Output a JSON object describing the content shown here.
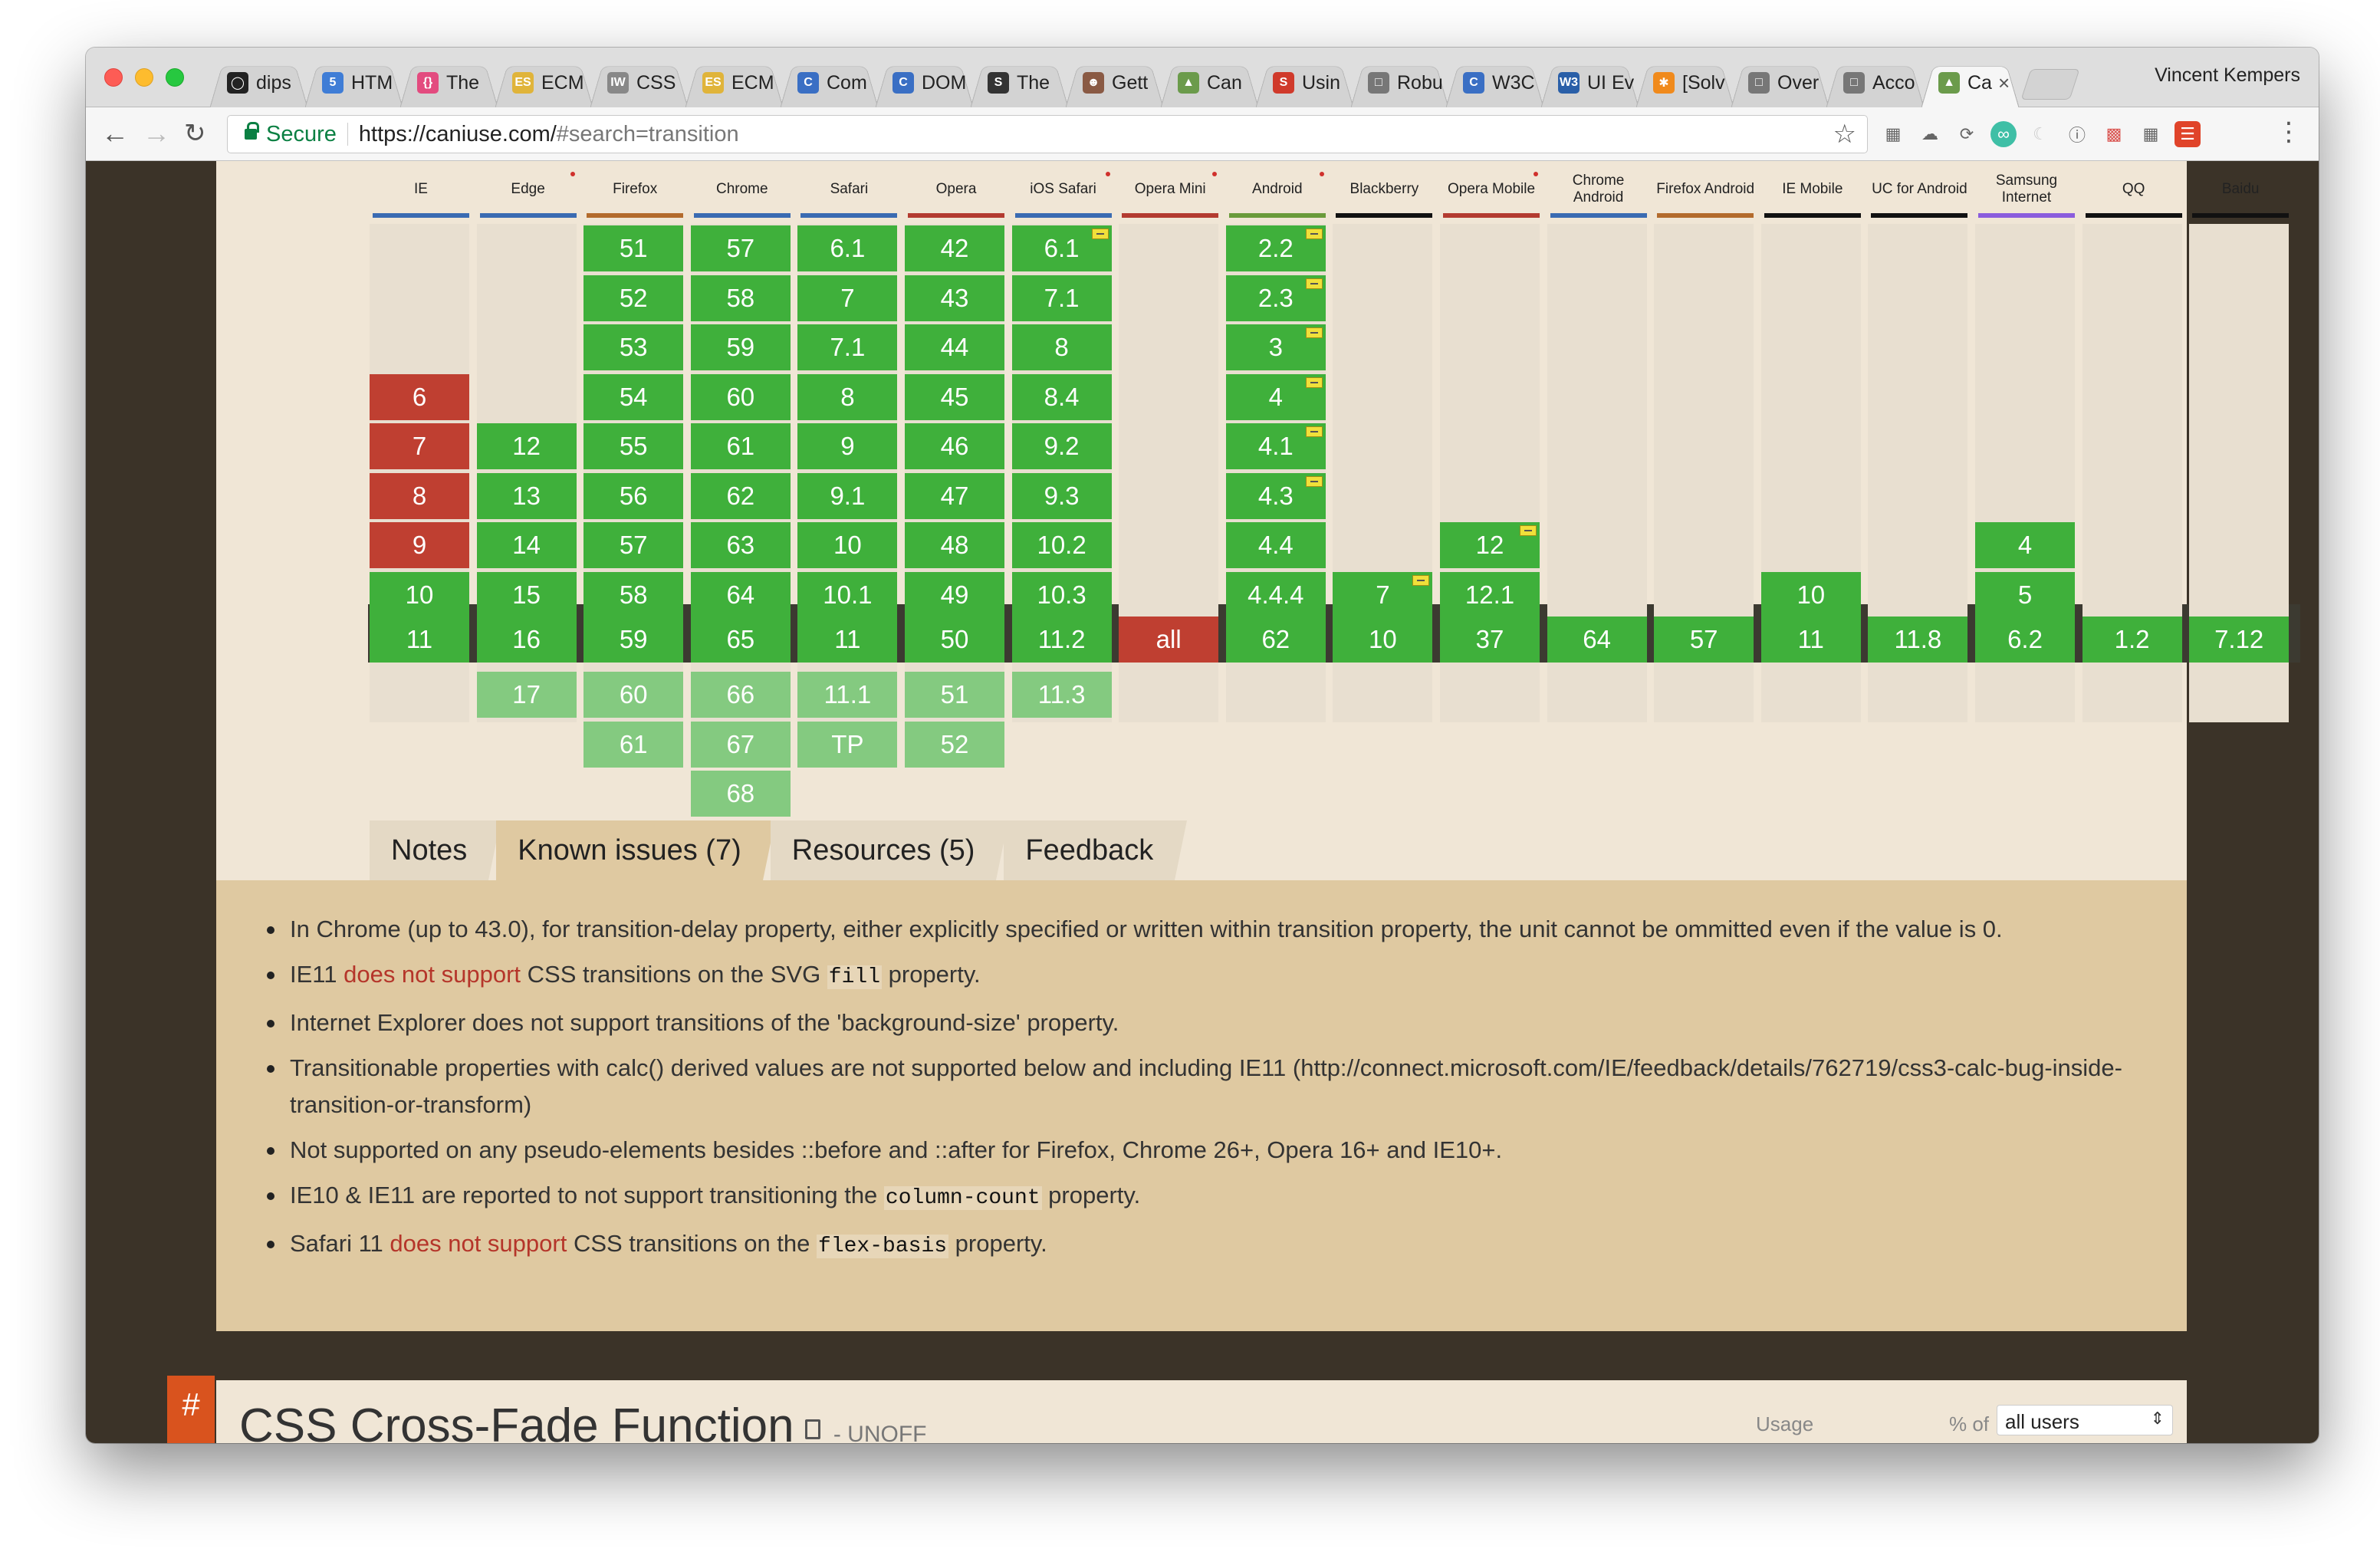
{
  "browser": {
    "tabs": [
      {
        "title": "dips",
        "icon": "github-icon",
        "color": "#222222"
      },
      {
        "title": "HTM",
        "icon": "html5-icon",
        "color": "#3f7dd6"
      },
      {
        "title": "The",
        "icon": "braces-icon",
        "color": "#e34b7f"
      },
      {
        "title": "ECM",
        "icon": "es-icon",
        "color": "#e0b43a"
      },
      {
        "title": "CSS",
        "icon": "iw-icon",
        "color": "#888888"
      },
      {
        "title": "ECM",
        "icon": "es-icon",
        "color": "#e0b43a"
      },
      {
        "title": "Com",
        "icon": "c-icon",
        "color": "#3a6fc4"
      },
      {
        "title": "DOM",
        "icon": "c-icon",
        "color": "#3a6fc4"
      },
      {
        "title": "The",
        "icon": "s-icon",
        "color": "#333333"
      },
      {
        "title": "Gett",
        "icon": "avatar-icon",
        "color": "#8a5a44"
      },
      {
        "title": "Can",
        "icon": "caniuse-icon",
        "color": "#6b9b4b"
      },
      {
        "title": "Usin",
        "icon": "s-red-icon",
        "color": "#d03a2b"
      },
      {
        "title": "Robu",
        "icon": "page-icon",
        "color": "#777777"
      },
      {
        "title": "W3C",
        "icon": "c-icon",
        "color": "#3a6fc4"
      },
      {
        "title": "UI Ev",
        "icon": "w3c-icon",
        "color": "#2a5fa8"
      },
      {
        "title": "[Solv",
        "icon": "asterisk-icon",
        "color": "#f08a1c"
      },
      {
        "title": "Over",
        "icon": "page-icon",
        "color": "#777777"
      },
      {
        "title": "Acco",
        "icon": "page-icon",
        "color": "#777777"
      },
      {
        "title": "Ca",
        "icon": "caniuse-icon",
        "color": "#6b9b4b",
        "active": true
      }
    ],
    "profile_name": "Vincent Kempers",
    "secure_label": "Secure",
    "url_host": "https://caniuse.com/",
    "url_rest": "#search=transition"
  },
  "browsers": [
    {
      "name": "IE",
      "color": "#3a6bb2",
      "dot": false
    },
    {
      "name": "Edge",
      "color": "#3a6bb2",
      "dot": true
    },
    {
      "name": "Firefox",
      "color": "#b36b2d",
      "dot": false
    },
    {
      "name": "Chrome",
      "color": "#3a6bb2",
      "dot": false
    },
    {
      "name": "Safari",
      "color": "#3a6bb2",
      "dot": false
    },
    {
      "name": "Opera",
      "color": "#b33b30",
      "dot": false
    },
    {
      "name": "iOS Safari",
      "color": "#3a6bb2",
      "dot": true
    },
    {
      "name": "Opera Mini",
      "color": "#b33b30",
      "dot": true
    },
    {
      "name": "Android",
      "color": "#6a9b3b",
      "dot": true
    },
    {
      "name": "Blackberry",
      "color": "#111111",
      "dot": false
    },
    {
      "name": "Opera Mobile",
      "color": "#b33b30",
      "dot": true
    },
    {
      "name": "Chrome Android",
      "color": "#3a6bb2",
      "dot": false
    },
    {
      "name": "Firefox Android",
      "color": "#b36b2d",
      "dot": false
    },
    {
      "name": "IE Mobile",
      "color": "#111111",
      "dot": false
    },
    {
      "name": "UC for Android",
      "color": "#111111",
      "dot": false
    },
    {
      "name": "Samsung Internet",
      "color": "#8a5cdd",
      "dot": false
    },
    {
      "name": "QQ",
      "color": "#111111",
      "dot": false
    },
    {
      "name": "Baidu",
      "color": "#111111",
      "dot": false
    }
  ],
  "support_columns": [
    {
      "past": [
        [
          "",
          "",
          false
        ],
        [
          "",
          "",
          false
        ],
        [
          "",
          "",
          false
        ],
        [
          "6",
          "n",
          false
        ],
        [
          "7",
          "n",
          false
        ],
        [
          "8",
          "n",
          false
        ],
        [
          "9",
          "n",
          false
        ],
        [
          "10",
          "y",
          false
        ]
      ],
      "current": [
        "11",
        "y"
      ],
      "future": []
    },
    {
      "past": [
        [
          "",
          "",
          false
        ],
        [
          "",
          "",
          false
        ],
        [
          "",
          "",
          false
        ],
        [
          "",
          "",
          false
        ],
        [
          "12",
          "y",
          false
        ],
        [
          "13",
          "y",
          false
        ],
        [
          "14",
          "y",
          false
        ],
        [
          "15",
          "y",
          false
        ]
      ],
      "current": [
        "16",
        "y"
      ],
      "future": [
        [
          "17",
          "f"
        ]
      ]
    },
    {
      "past": [
        [
          "51",
          "y",
          false
        ],
        [
          "52",
          "y",
          false
        ],
        [
          "53",
          "y",
          false
        ],
        [
          "54",
          "y",
          false
        ],
        [
          "55",
          "y",
          false
        ],
        [
          "56",
          "y",
          false
        ],
        [
          "57",
          "y",
          false
        ],
        [
          "58",
          "y",
          false
        ]
      ],
      "current": [
        "59",
        "y"
      ],
      "future": [
        [
          "60",
          "f"
        ],
        [
          "61",
          "f"
        ]
      ]
    },
    {
      "past": [
        [
          "57",
          "y",
          false
        ],
        [
          "58",
          "y",
          false
        ],
        [
          "59",
          "y",
          false
        ],
        [
          "60",
          "y",
          false
        ],
        [
          "61",
          "y",
          false
        ],
        [
          "62",
          "y",
          false
        ],
        [
          "63",
          "y",
          false
        ],
        [
          "64",
          "y",
          false
        ]
      ],
      "current": [
        "65",
        "y"
      ],
      "future": [
        [
          "66",
          "f"
        ],
        [
          "67",
          "f"
        ],
        [
          "68",
          "f"
        ]
      ]
    },
    {
      "past": [
        [
          "6.1",
          "y",
          false
        ],
        [
          "7",
          "y",
          false
        ],
        [
          "7.1",
          "y",
          false
        ],
        [
          "8",
          "y",
          false
        ],
        [
          "9",
          "y",
          false
        ],
        [
          "9.1",
          "y",
          false
        ],
        [
          "10",
          "y",
          false
        ],
        [
          "10.1",
          "y",
          false
        ]
      ],
      "current": [
        "11",
        "y"
      ],
      "future": [
        [
          "11.1",
          "f"
        ],
        [
          "TP",
          "f"
        ]
      ]
    },
    {
      "past": [
        [
          "42",
          "y",
          false
        ],
        [
          "43",
          "y",
          false
        ],
        [
          "44",
          "y",
          false
        ],
        [
          "45",
          "y",
          false
        ],
        [
          "46",
          "y",
          false
        ],
        [
          "47",
          "y",
          false
        ],
        [
          "48",
          "y",
          false
        ],
        [
          "49",
          "y",
          false
        ]
      ],
      "current": [
        "50",
        "y"
      ],
      "future": [
        [
          "51",
          "f"
        ],
        [
          "52",
          "f"
        ]
      ]
    },
    {
      "past": [
        [
          "6.1",
          "y",
          true
        ],
        [
          "7.1",
          "y",
          false
        ],
        [
          "8",
          "y",
          false
        ],
        [
          "8.4",
          "y",
          false
        ],
        [
          "9.2",
          "y",
          false
        ],
        [
          "9.3",
          "y",
          false
        ],
        [
          "10.2",
          "y",
          false
        ],
        [
          "10.3",
          "y",
          false
        ]
      ],
      "current": [
        "11.2",
        "y"
      ],
      "future": [
        [
          "11.3",
          "f"
        ]
      ]
    },
    {
      "past": [
        [
          "",
          "",
          false
        ],
        [
          "",
          "",
          false
        ],
        [
          "",
          "",
          false
        ],
        [
          "",
          "",
          false
        ],
        [
          "",
          "",
          false
        ],
        [
          "",
          "",
          false
        ],
        [
          "",
          "",
          false
        ],
        [
          "",
          "",
          false
        ]
      ],
      "current": [
        "all",
        "n"
      ],
      "future": []
    },
    {
      "past": [
        [
          "2.2",
          "y",
          true
        ],
        [
          "2.3",
          "y",
          true
        ],
        [
          "3",
          "y",
          true
        ],
        [
          "4",
          "y",
          true
        ],
        [
          "4.1",
          "y",
          true
        ],
        [
          "4.3",
          "y",
          true
        ],
        [
          "4.4",
          "y",
          false
        ],
        [
          "4.4.4",
          "y",
          false
        ]
      ],
      "current": [
        "62",
        "y"
      ],
      "future": []
    },
    {
      "past": [
        [
          "",
          "",
          false
        ],
        [
          "",
          "",
          false
        ],
        [
          "",
          "",
          false
        ],
        [
          "",
          "",
          false
        ],
        [
          "",
          "",
          false
        ],
        [
          "",
          "",
          false
        ],
        [
          "",
          "",
          false
        ],
        [
          "7",
          "y",
          true
        ]
      ],
      "current": [
        "10",
        "y"
      ],
      "future": []
    },
    {
      "past": [
        [
          "",
          "",
          false
        ],
        [
          "",
          "",
          false
        ],
        [
          "",
          "",
          false
        ],
        [
          "",
          "",
          false
        ],
        [
          "",
          "",
          false
        ],
        [
          "",
          "",
          false
        ],
        [
          "12",
          "y",
          true
        ],
        [
          "12.1",
          "y",
          false
        ]
      ],
      "current": [
        "37",
        "y"
      ],
      "future": []
    },
    {
      "past": [
        [
          "",
          "",
          false
        ],
        [
          "",
          "",
          false
        ],
        [
          "",
          "",
          false
        ],
        [
          "",
          "",
          false
        ],
        [
          "",
          "",
          false
        ],
        [
          "",
          "",
          false
        ],
        [
          "",
          "",
          false
        ],
        [
          "",
          "",
          false
        ]
      ],
      "current": [
        "64",
        "y"
      ],
      "future": []
    },
    {
      "past": [
        [
          "",
          "",
          false
        ],
        [
          "",
          "",
          false
        ],
        [
          "",
          "",
          false
        ],
        [
          "",
          "",
          false
        ],
        [
          "",
          "",
          false
        ],
        [
          "",
          "",
          false
        ],
        [
          "",
          "",
          false
        ],
        [
          "",
          "",
          false
        ]
      ],
      "current": [
        "57",
        "y"
      ],
      "future": []
    },
    {
      "past": [
        [
          "",
          "",
          false
        ],
        [
          "",
          "",
          false
        ],
        [
          "",
          "",
          false
        ],
        [
          "",
          "",
          false
        ],
        [
          "",
          "",
          false
        ],
        [
          "",
          "",
          false
        ],
        [
          "",
          "",
          false
        ],
        [
          "10",
          "y",
          false
        ]
      ],
      "current": [
        "11",
        "y"
      ],
      "future": []
    },
    {
      "past": [
        [
          "",
          "",
          false
        ],
        [
          "",
          "",
          false
        ],
        [
          "",
          "",
          false
        ],
        [
          "",
          "",
          false
        ],
        [
          "",
          "",
          false
        ],
        [
          "",
          "",
          false
        ],
        [
          "",
          "",
          false
        ],
        [
          "",
          "",
          false
        ]
      ],
      "current": [
        "11.8",
        "y"
      ],
      "future": []
    },
    {
      "past": [
        [
          "",
          "",
          false
        ],
        [
          "",
          "",
          false
        ],
        [
          "",
          "",
          false
        ],
        [
          "",
          "",
          false
        ],
        [
          "",
          "",
          false
        ],
        [
          "",
          "",
          false
        ],
        [
          "4",
          "y",
          false
        ],
        [
          "5",
          "y",
          false
        ]
      ],
      "current": [
        "6.2",
        "y"
      ],
      "future": []
    },
    {
      "past": [
        [
          "",
          "",
          false
        ],
        [
          "",
          "",
          false
        ],
        [
          "",
          "",
          false
        ],
        [
          "",
          "",
          false
        ],
        [
          "",
          "",
          false
        ],
        [
          "",
          "",
          false
        ],
        [
          "",
          "",
          false
        ],
        [
          "",
          "",
          false
        ]
      ],
      "current": [
        "1.2",
        "y"
      ],
      "future": []
    },
    {
      "past": [
        [
          "",
          "",
          false
        ],
        [
          "",
          "",
          false
        ],
        [
          "",
          "",
          false
        ],
        [
          "",
          "",
          false
        ],
        [
          "",
          "",
          false
        ],
        [
          "",
          "",
          false
        ],
        [
          "",
          "",
          false
        ],
        [
          "",
          "",
          false
        ]
      ],
      "current": [
        "7.12",
        "y"
      ],
      "future": []
    }
  ],
  "info_tabs": [
    {
      "label": "Notes",
      "active": false
    },
    {
      "label": "Known issues (7)",
      "active": true
    },
    {
      "label": "Resources (5)",
      "active": false
    },
    {
      "label": "Feedback",
      "active": false
    }
  ],
  "known_issues": [
    {
      "parts": [
        {
          "t": "text",
          "v": "In Chrome (up to 43.0), for transition-delay property, either explicitly specified or written within transition property, the unit cannot be ommitted even if the value is 0."
        }
      ]
    },
    {
      "parts": [
        {
          "t": "text",
          "v": "IE11 "
        },
        {
          "t": "link",
          "v": "does not support"
        },
        {
          "t": "text",
          "v": " CSS transitions on the SVG "
        },
        {
          "t": "code",
          "v": "fill"
        },
        {
          "t": "text",
          "v": " property."
        }
      ]
    },
    {
      "parts": [
        {
          "t": "text",
          "v": "Internet Explorer does not support transitions of the 'background-size' property."
        }
      ]
    },
    {
      "parts": [
        {
          "t": "text",
          "v": "Transitionable properties with calc() derived values are not supported below and including IE11 (http://connect.microsoft.com/IE/feedback/details/762719/css3-calc-bug-inside-transition-or-transform)"
        }
      ]
    },
    {
      "parts": [
        {
          "t": "text",
          "v": "Not supported on any pseudo-elements besides ::before and ::after for Firefox, Chrome 26+, Opera 16+ and IE10+."
        }
      ]
    },
    {
      "parts": [
        {
          "t": "text",
          "v": "IE10 & IE11 are reported to not support transitioning the "
        },
        {
          "t": "code",
          "v": "column-count"
        },
        {
          "t": "text",
          "v": " property."
        }
      ]
    },
    {
      "parts": [
        {
          "t": "text",
          "v": "Safari 11 "
        },
        {
          "t": "link",
          "v": "does not support"
        },
        {
          "t": "text",
          "v": " CSS transitions on the "
        },
        {
          "t": "code",
          "v": "flex-basis"
        },
        {
          "t": "text",
          "v": " property."
        }
      ]
    }
  ],
  "next_feature": {
    "hash": "#",
    "title": "CSS Cross-Fade Function",
    "status": "- UNOFF",
    "usage_label": "Usage",
    "pct_of_label": "% of",
    "users_value": "all users"
  },
  "colors": {
    "supported": "#3fb03b",
    "unsupported": "#bf3f31",
    "future": "#84ca80",
    "panel": "#dfc9a1",
    "page_bg": "#3b3328"
  }
}
